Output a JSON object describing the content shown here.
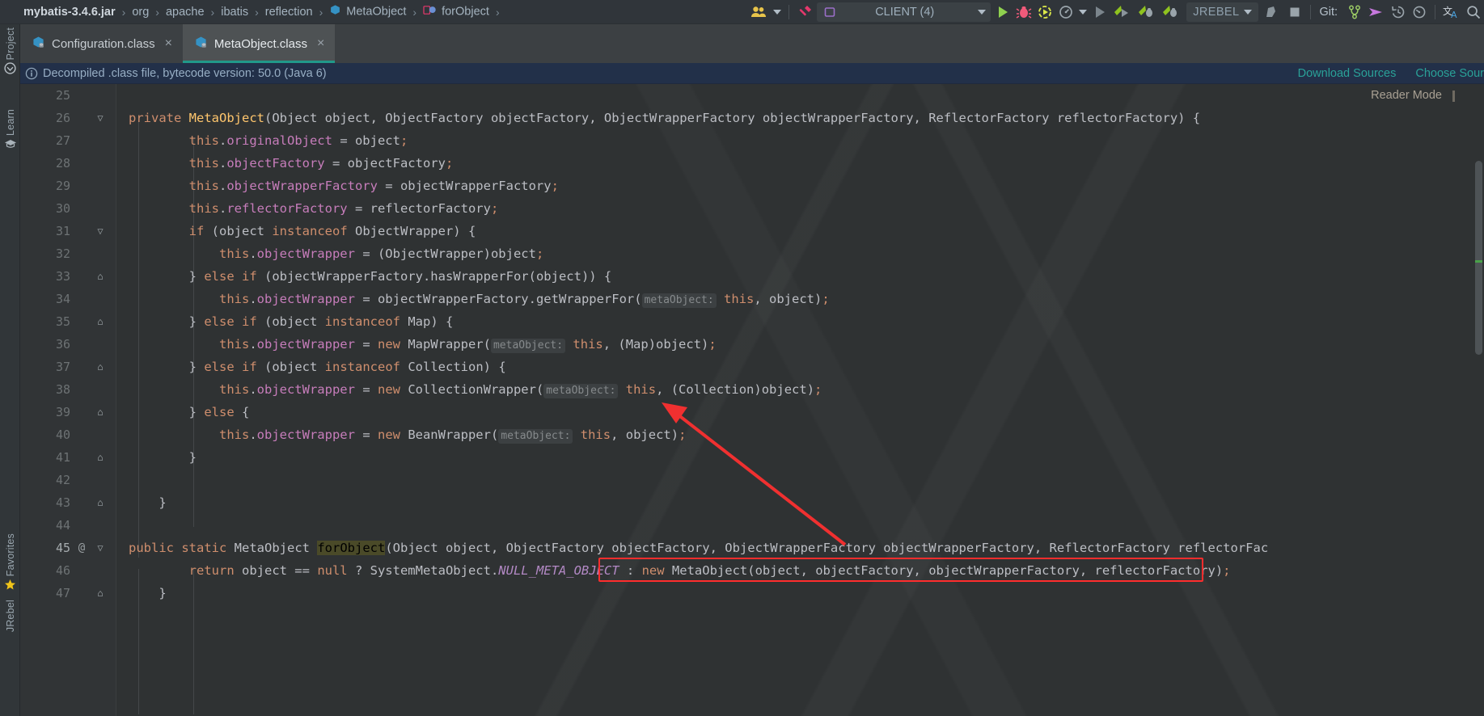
{
  "toolbar": {
    "breadcrumb": [
      {
        "label": "mybatis-3.4.6.jar",
        "bold": true,
        "icon": "jar-icon"
      },
      {
        "label": "org",
        "bold": false,
        "icon": ""
      },
      {
        "label": "apache",
        "bold": false,
        "icon": ""
      },
      {
        "label": "ibatis",
        "bold": false,
        "icon": ""
      },
      {
        "label": "reflection",
        "bold": false,
        "icon": ""
      },
      {
        "label": "MetaObject",
        "bold": false,
        "icon": "class-icon"
      },
      {
        "label": "forObject",
        "bold": false,
        "icon": "method-icon"
      }
    ],
    "separator": "›",
    "run_config": "CLIENT (4)",
    "jrebel_label": "JREBEL",
    "git_label": "Git:",
    "icons": [
      "users-icon",
      "hammer-icon",
      "run-icon",
      "debug-icon",
      "run-with-coverage-icon",
      "profiler-icon",
      "run-gray-icon",
      "jrebel-run-icon",
      "jrebel-debug-icon",
      "jrebel-extra-icon",
      "stop-icon",
      "git-branch-icon",
      "git-push-icon",
      "git-history-icon",
      "git-rollback-icon",
      "translate-icon",
      "search-icon"
    ]
  },
  "rail": {
    "items": [
      {
        "label": "Project",
        "icon": "project-icon"
      },
      {
        "label": "Learn",
        "icon": "learn-icon"
      },
      {
        "label": "Favorites",
        "icon": "star-icon"
      },
      {
        "label": "JRebel",
        "icon": "jrebel-icon"
      }
    ]
  },
  "tabs": [
    {
      "label": "Configuration.class",
      "icon": "class-file-icon",
      "active": false,
      "close": "×"
    },
    {
      "label": "MetaObject.class",
      "icon": "class-file-icon",
      "active": true,
      "close": "×"
    }
  ],
  "notice": {
    "text": "Decompiled .class file, bytecode version: 50.0 (Java 6)",
    "links": [
      "Download Sources",
      "Choose Sour"
    ]
  },
  "editor": {
    "reader_mode": "Reader Mode",
    "first_line": 25,
    "lines": [
      {
        "num": "25",
        "fold": "",
        "ann": "",
        "indent": 0,
        "tokens": []
      },
      {
        "num": "26",
        "fold": "▽",
        "ann": "",
        "indent": 0,
        "tokens": [
          {
            "t": "private",
            "c": "kw"
          },
          {
            "t": " ",
            "c": "id"
          },
          {
            "t": "MetaObject",
            "c": "decl"
          },
          {
            "t": "(Object object, ObjectFactory objectFactory, ObjectWrapperFactory objectWrapperFactory, ReflectorFactory reflectorFactory) {",
            "c": "id"
          }
        ]
      },
      {
        "num": "27",
        "fold": "",
        "ann": "",
        "indent": 1,
        "tokens": [
          {
            "t": "        ",
            "c": "id"
          },
          {
            "t": "this",
            "c": "kw"
          },
          {
            "t": ".",
            "c": "id"
          },
          {
            "t": "originalObject",
            "c": "fld"
          },
          {
            "t": " = object",
            "c": "id"
          },
          {
            "t": ";",
            "c": "semi"
          }
        ]
      },
      {
        "num": "28",
        "fold": "",
        "ann": "",
        "indent": 1,
        "tokens": [
          {
            "t": "        ",
            "c": "id"
          },
          {
            "t": "this",
            "c": "kw"
          },
          {
            "t": ".",
            "c": "id"
          },
          {
            "t": "objectFactory",
            "c": "fld"
          },
          {
            "t": " = objectFactory",
            "c": "id"
          },
          {
            "t": ";",
            "c": "semi"
          }
        ]
      },
      {
        "num": "29",
        "fold": "",
        "ann": "",
        "indent": 1,
        "tokens": [
          {
            "t": "        ",
            "c": "id"
          },
          {
            "t": "this",
            "c": "kw"
          },
          {
            "t": ".",
            "c": "id"
          },
          {
            "t": "objectWrapperFactory",
            "c": "fld"
          },
          {
            "t": " = objectWrapperFactory",
            "c": "id"
          },
          {
            "t": ";",
            "c": "semi"
          }
        ]
      },
      {
        "num": "30",
        "fold": "",
        "ann": "",
        "indent": 1,
        "tokens": [
          {
            "t": "        ",
            "c": "id"
          },
          {
            "t": "this",
            "c": "kw"
          },
          {
            "t": ".",
            "c": "id"
          },
          {
            "t": "reflectorFactory",
            "c": "fld"
          },
          {
            "t": " = reflectorFactory",
            "c": "id"
          },
          {
            "t": ";",
            "c": "semi"
          }
        ]
      },
      {
        "num": "31",
        "fold": "▽",
        "ann": "",
        "indent": 1,
        "tokens": [
          {
            "t": "        ",
            "c": "id"
          },
          {
            "t": "if",
            "c": "kw"
          },
          {
            "t": " (object ",
            "c": "id"
          },
          {
            "t": "instanceof",
            "c": "kw"
          },
          {
            "t": " ObjectWrapper) {",
            "c": "id"
          }
        ]
      },
      {
        "num": "32",
        "fold": "",
        "ann": "",
        "indent": 2,
        "tokens": [
          {
            "t": "            ",
            "c": "id"
          },
          {
            "t": "this",
            "c": "kw"
          },
          {
            "t": ".",
            "c": "id"
          },
          {
            "t": "objectWrapper",
            "c": "fld"
          },
          {
            "t": " = (ObjectWrapper)object",
            "c": "id"
          },
          {
            "t": ";",
            "c": "semi"
          }
        ]
      },
      {
        "num": "33",
        "fold": "⌂",
        "ann": "",
        "indent": 1,
        "tokens": [
          {
            "t": "        } ",
            "c": "id"
          },
          {
            "t": "else",
            "c": "kw"
          },
          {
            "t": " ",
            "c": "id"
          },
          {
            "t": "if",
            "c": "kw"
          },
          {
            "t": " (objectWrapperFactory.hasWrapperFor(object)) {",
            "c": "id"
          }
        ]
      },
      {
        "num": "34",
        "fold": "",
        "ann": "",
        "indent": 2,
        "tokens": [
          {
            "t": "            ",
            "c": "id"
          },
          {
            "t": "this",
            "c": "kw"
          },
          {
            "t": ".",
            "c": "id"
          },
          {
            "t": "objectWrapper",
            "c": "fld"
          },
          {
            "t": " = objectWrapperFactory.getWrapperFor(",
            "c": "id"
          },
          {
            "t": "metaObject:",
            "c": "hint"
          },
          {
            "t": " ",
            "c": "id"
          },
          {
            "t": "this",
            "c": "kw"
          },
          {
            "t": ", object)",
            "c": "id"
          },
          {
            "t": ";",
            "c": "semi"
          }
        ]
      },
      {
        "num": "35",
        "fold": "⌂",
        "ann": "",
        "indent": 1,
        "tokens": [
          {
            "t": "        } ",
            "c": "id"
          },
          {
            "t": "else",
            "c": "kw"
          },
          {
            "t": " ",
            "c": "id"
          },
          {
            "t": "if",
            "c": "kw"
          },
          {
            "t": " (object ",
            "c": "id"
          },
          {
            "t": "instanceof",
            "c": "kw"
          },
          {
            "t": " Map) {",
            "c": "id"
          }
        ]
      },
      {
        "num": "36",
        "fold": "",
        "ann": "",
        "indent": 2,
        "tokens": [
          {
            "t": "            ",
            "c": "id"
          },
          {
            "t": "this",
            "c": "kw"
          },
          {
            "t": ".",
            "c": "id"
          },
          {
            "t": "objectWrapper",
            "c": "fld"
          },
          {
            "t": " = ",
            "c": "id"
          },
          {
            "t": "new",
            "c": "kw"
          },
          {
            "t": " MapWrapper(",
            "c": "id"
          },
          {
            "t": "metaObject:",
            "c": "hint"
          },
          {
            "t": " ",
            "c": "id"
          },
          {
            "t": "this",
            "c": "kw"
          },
          {
            "t": ", (Map)object)",
            "c": "id"
          },
          {
            "t": ";",
            "c": "semi"
          }
        ]
      },
      {
        "num": "37",
        "fold": "⌂",
        "ann": "",
        "indent": 1,
        "tokens": [
          {
            "t": "        } ",
            "c": "id"
          },
          {
            "t": "else",
            "c": "kw"
          },
          {
            "t": " ",
            "c": "id"
          },
          {
            "t": "if",
            "c": "kw"
          },
          {
            "t": " (object ",
            "c": "id"
          },
          {
            "t": "instanceof",
            "c": "kw"
          },
          {
            "t": " Collection) {",
            "c": "id"
          }
        ]
      },
      {
        "num": "38",
        "fold": "",
        "ann": "",
        "indent": 2,
        "tokens": [
          {
            "t": "            ",
            "c": "id"
          },
          {
            "t": "this",
            "c": "kw"
          },
          {
            "t": ".",
            "c": "id"
          },
          {
            "t": "objectWrapper",
            "c": "fld"
          },
          {
            "t": " = ",
            "c": "id"
          },
          {
            "t": "new",
            "c": "kw"
          },
          {
            "t": " CollectionWrapper(",
            "c": "id"
          },
          {
            "t": "metaObject:",
            "c": "hint"
          },
          {
            "t": " ",
            "c": "id"
          },
          {
            "t": "this",
            "c": "kw"
          },
          {
            "t": ", (Collection)object)",
            "c": "id"
          },
          {
            "t": ";",
            "c": "semi"
          }
        ]
      },
      {
        "num": "39",
        "fold": "⌂",
        "ann": "",
        "indent": 1,
        "tokens": [
          {
            "t": "        } ",
            "c": "id"
          },
          {
            "t": "else",
            "c": "kw"
          },
          {
            "t": " {",
            "c": "id"
          }
        ]
      },
      {
        "num": "40",
        "fold": "",
        "ann": "",
        "indent": 2,
        "tokens": [
          {
            "t": "            ",
            "c": "id"
          },
          {
            "t": "this",
            "c": "kw"
          },
          {
            "t": ".",
            "c": "id"
          },
          {
            "t": "objectWrapper",
            "c": "fld"
          },
          {
            "t": " = ",
            "c": "id"
          },
          {
            "t": "new",
            "c": "kw"
          },
          {
            "t": " BeanWrapper(",
            "c": "id"
          },
          {
            "t": "metaObject:",
            "c": "hint"
          },
          {
            "t": " ",
            "c": "id"
          },
          {
            "t": "this",
            "c": "kw"
          },
          {
            "t": ", object)",
            "c": "id"
          },
          {
            "t": ";",
            "c": "semi"
          }
        ]
      },
      {
        "num": "41",
        "fold": "⌂",
        "ann": "",
        "indent": 1,
        "tokens": [
          {
            "t": "        }",
            "c": "id"
          }
        ]
      },
      {
        "num": "42",
        "fold": "",
        "ann": "",
        "indent": 0,
        "tokens": []
      },
      {
        "num": "43",
        "fold": "⌂",
        "ann": "",
        "indent": 0,
        "tokens": [
          {
            "t": "    }",
            "c": "id"
          }
        ]
      },
      {
        "num": "44",
        "fold": "",
        "ann": "",
        "indent": 0,
        "tokens": []
      },
      {
        "num": "45",
        "fold": "▽",
        "ann": "@",
        "indent": 0,
        "tokens": [
          {
            "t": "public",
            "c": "kw"
          },
          {
            "t": " ",
            "c": "id"
          },
          {
            "t": "static",
            "c": "kw"
          },
          {
            "t": " MetaObject ",
            "c": "id"
          },
          {
            "t": "forObject",
            "c": "usagehl"
          },
          {
            "t": "(Object object, ObjectFactory objectFactory, ObjectWrapperFactory objectWrapperFactory, ReflectorFactory reflectorFac",
            "c": "id"
          }
        ]
      },
      {
        "num": "46",
        "fold": "",
        "ann": "",
        "indent": 1,
        "tokens": [
          {
            "t": "        ",
            "c": "id"
          },
          {
            "t": "return",
            "c": "kw"
          },
          {
            "t": " object == ",
            "c": "id"
          },
          {
            "t": "null",
            "c": "kw"
          },
          {
            "t": " ? SystemMetaObject.",
            "c": "id"
          },
          {
            "t": "NULL_META_OBJECT",
            "c": "sfld"
          },
          {
            "t": " : ",
            "c": "id"
          },
          {
            "t": "new",
            "c": "kw"
          },
          {
            "t": " MetaObject(object, objectFactory, objectWrapperFactory, reflectorFactory)",
            "c": "id"
          },
          {
            "t": ";",
            "c": "semi"
          }
        ]
      },
      {
        "num": "47",
        "fold": "⌂",
        "ann": "",
        "indent": 0,
        "tokens": [
          {
            "t": "    }",
            "c": "id"
          }
        ]
      }
    ],
    "annotation_box": {
      "name": "red-highlight-box",
      "note": "red rectangle around 'new MetaObject(...);' on line 46"
    },
    "arrow": {
      "name": "red-arrow-annotation",
      "color": "#f03030"
    }
  },
  "colors": {
    "accent_tab_underline": "#21998a",
    "notice_bg": "#223049",
    "link": "#2aa198",
    "editor_bg": "#2f3233",
    "annotation_red": "#ff2d2d",
    "keyword": "#cf8e6d",
    "field": "#c77dbb",
    "declaration": "#ffc66d",
    "usage_highlight": "#4a4a28"
  }
}
